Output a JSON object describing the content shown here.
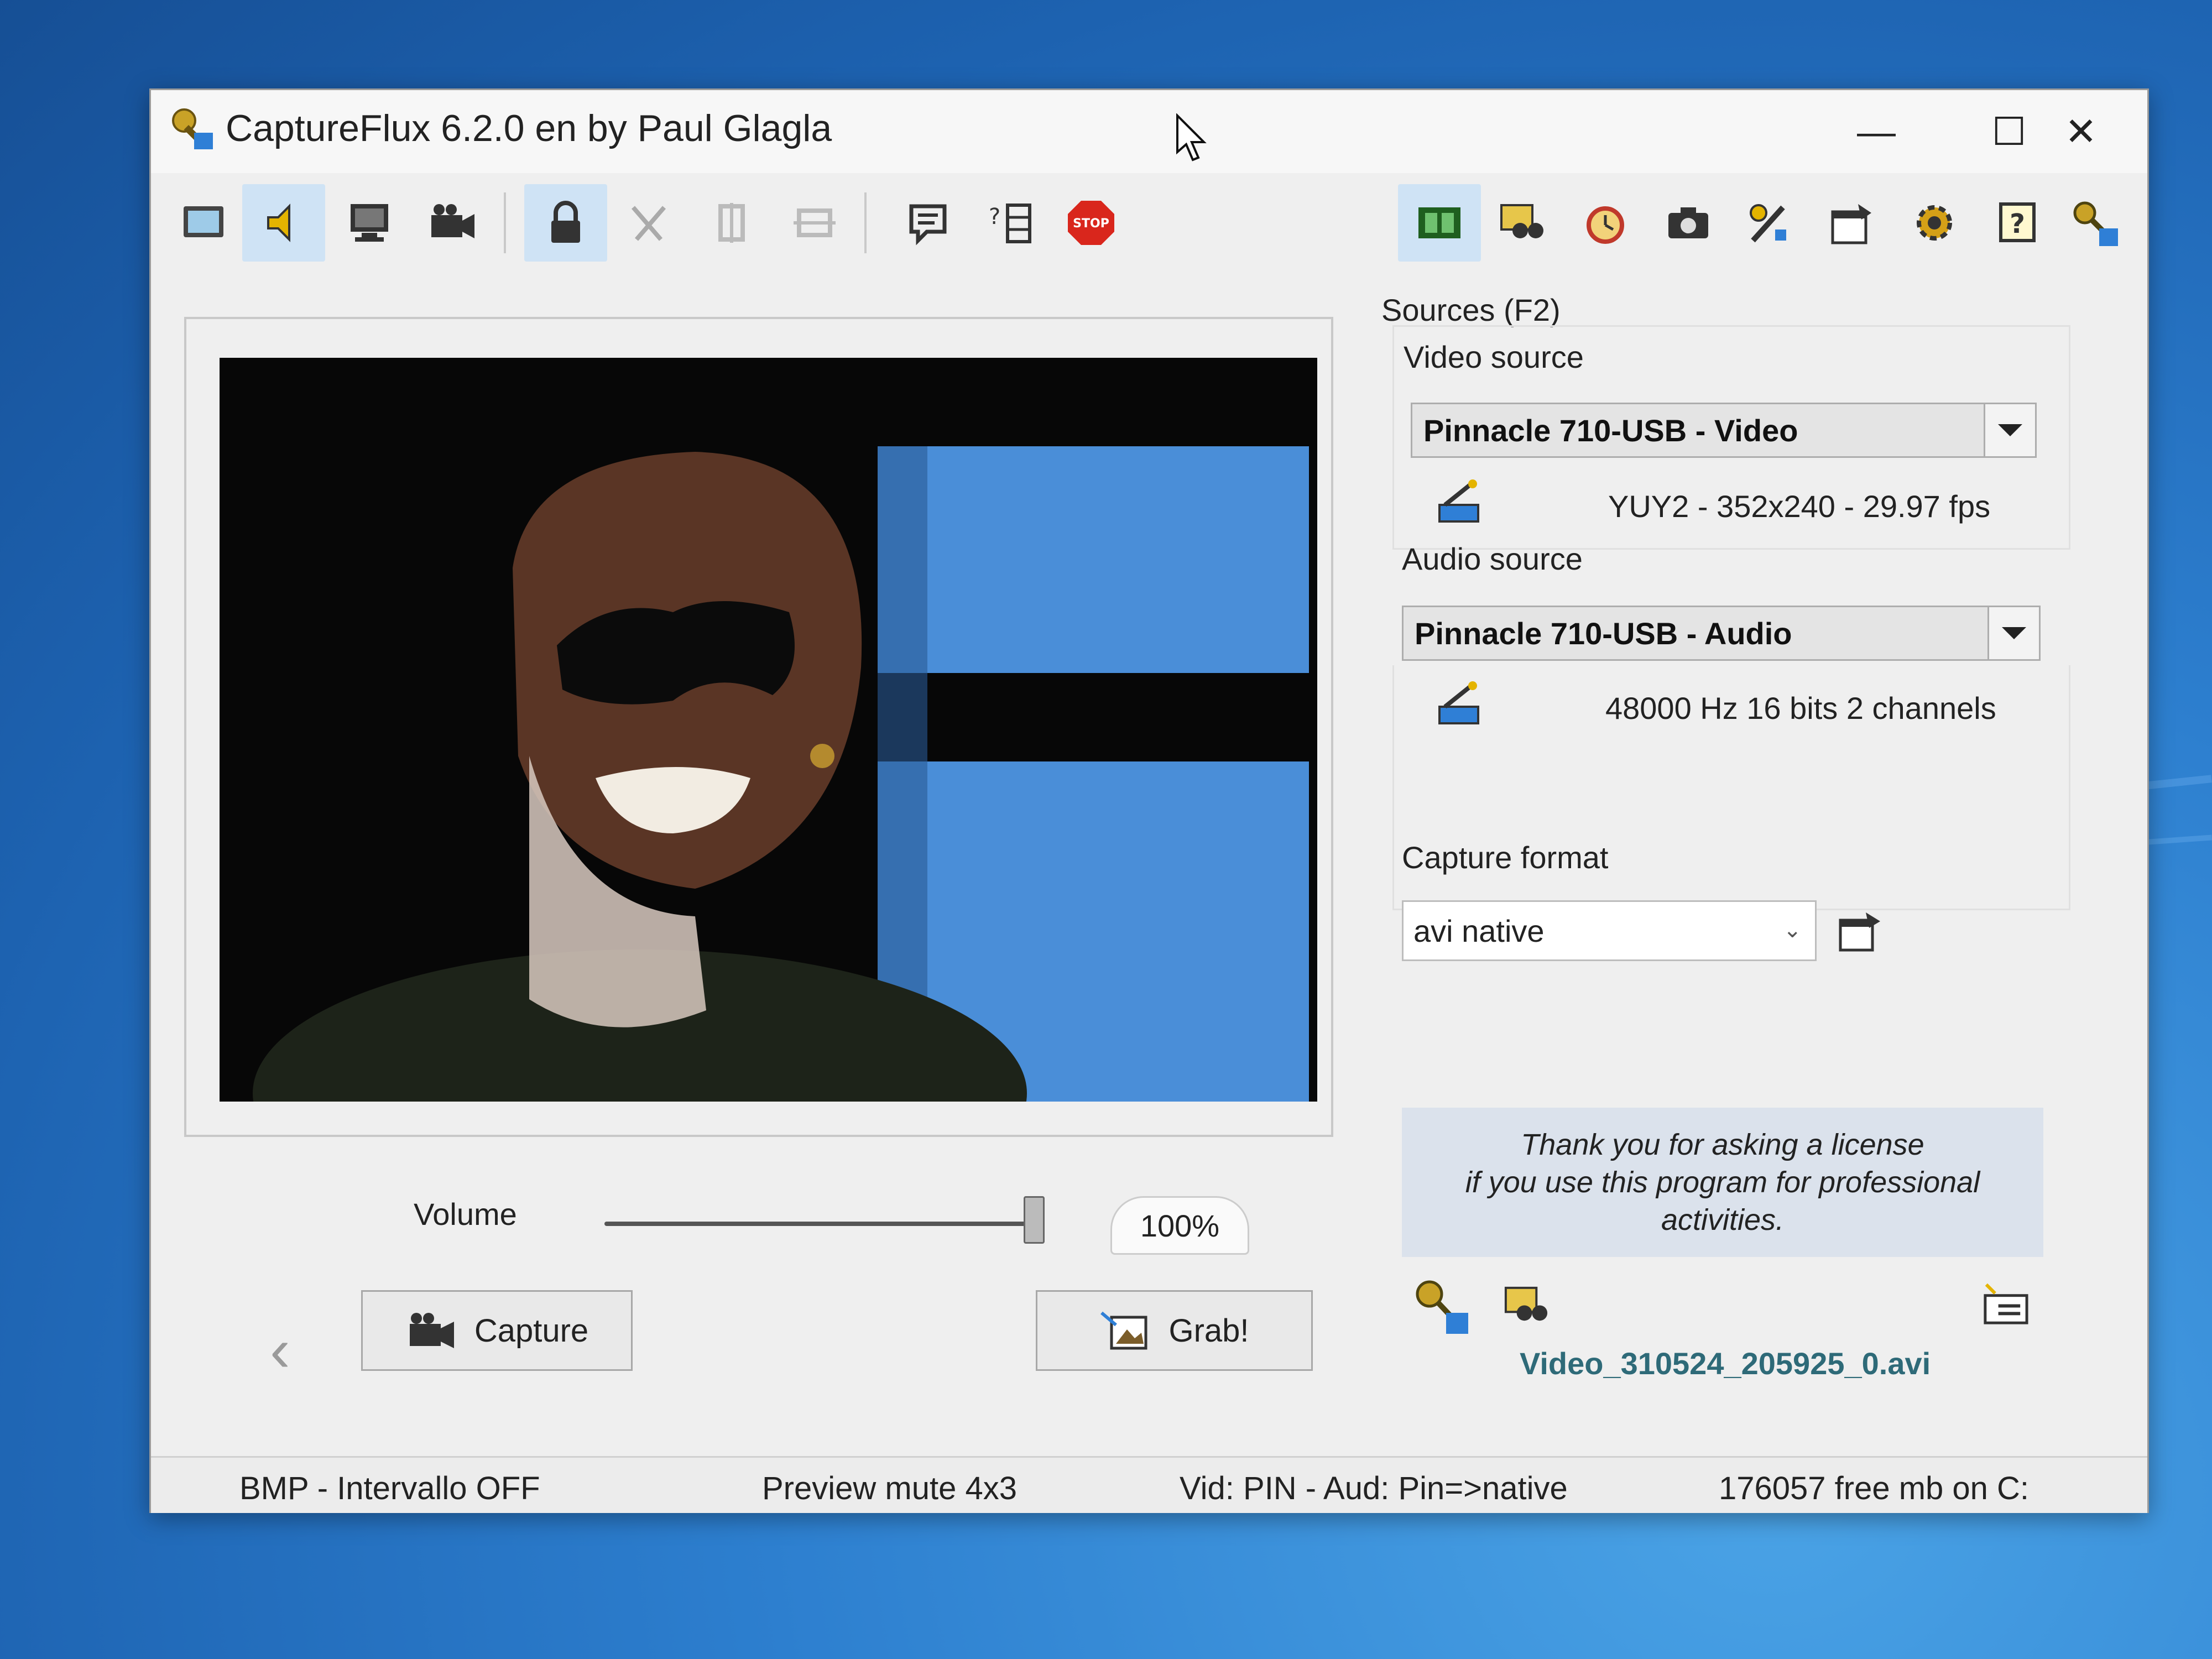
{
  "window": {
    "title": "CaptureFlux 6.2.0 en by Paul Glagla",
    "controls": {
      "minimize": "—",
      "maximize": "☐",
      "close": "✕"
    }
  },
  "toolbar": {
    "left_icons": [
      "screen-icon",
      "speaker-icon",
      "monitor-icon",
      "camcorder-icon",
      "lock-icon",
      "cut-icon",
      "split-icon",
      "join-icon",
      "note-icon",
      "list-icon",
      "stop-icon"
    ],
    "stop_label": "STOP",
    "right_icons": [
      "film-icon",
      "binoculars-icon",
      "alarm-clock-icon",
      "camera-icon",
      "tools-icon",
      "properties-icon",
      "settings-gear-icon",
      "help-icon",
      "key-icon"
    ]
  },
  "preview": {
    "volume_label": "Volume",
    "volume_value": 100,
    "volume_text": "100%",
    "capture_label": "Capture",
    "grab_label": "Grab!",
    "prev_symbol": "‹"
  },
  "sources": {
    "title": "Sources (F2)",
    "video_label": "Video source",
    "video_device": "Pinnacle 710-USB - Video",
    "video_info": "YUY2 - 352x240 - 29.97 fps",
    "audio_label": "Audio source",
    "audio_device": "Pinnacle 710-USB - Audio",
    "audio_info": "48000 Hz 16 bits 2 channels",
    "format_label": "Capture format",
    "format_value": "avi native",
    "license_line1": "Thank you for asking a license",
    "license_line2": "if you use this program for professional",
    "license_line3": "activities.",
    "filename": "Video_310524_205925_0.avi"
  },
  "statusbar": {
    "image": "BMP - Intervallo OFF",
    "preview": "Preview mute 4x3",
    "sources": "Vid: PIN - Aud: Pin=>native",
    "disk": "176057 free mb on C:"
  },
  "colors": {
    "stop_red": "#d9261c",
    "link_teal": "#2e6a78",
    "video_blue": "#4a8ed8",
    "active_bg": "#cfe3f5"
  }
}
